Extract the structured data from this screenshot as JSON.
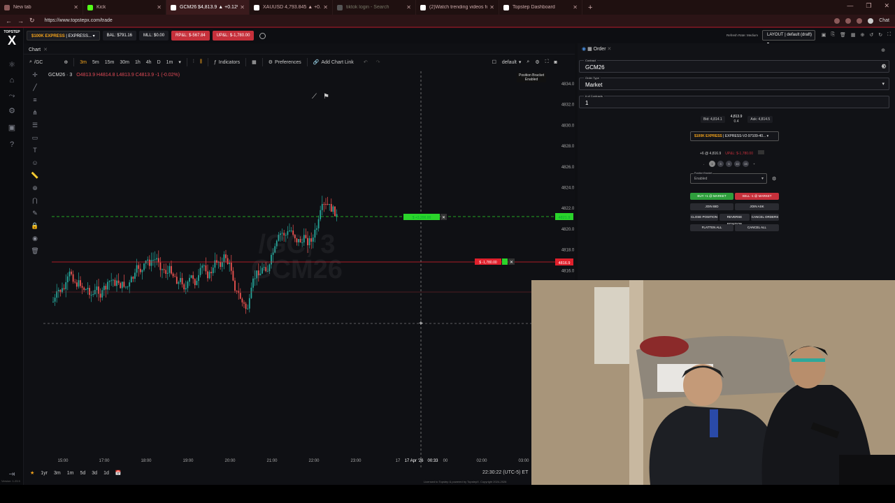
{
  "browser": {
    "tabs": [
      {
        "label": "New tab",
        "color": "#8b5a5a",
        "active": false
      },
      {
        "label": "Kick",
        "color": "#53fc18",
        "active": false
      },
      {
        "label": "GCM26 $4,813.9 ▲ +0.12%",
        "color": "#ffffff",
        "active": true
      },
      {
        "label": "XAUUSD 4,793.845 ▲ +0.07% Un",
        "color": "#ffffff",
        "active": false
      },
      {
        "label": "tiktok login - Search",
        "color": "#6a6a6a",
        "active": false
      },
      {
        "label": "(2)Watch trending videos for you",
        "color": "#ffffff",
        "active": false
      },
      {
        "label": "Topstep Dashboard",
        "color": "#ffffff",
        "active": false
      }
    ],
    "url": "https://www.topstepx.com/trade",
    "chat_label": "Chat"
  },
  "logo": {
    "top": "TOPSTEP",
    "mark": "X"
  },
  "infobar": {
    "account_prefix": "$100K EXPRESS",
    "account_suffix": " | EXPRESS...",
    "balance": "BAL: $791.16",
    "mll": "MLL: $0.00",
    "rpl": "RP&L: $-567.84",
    "upl": "UP&L: $-1,780.00",
    "refresh_rate": "Refresh Rate: Medium",
    "layout": "LAYOUT | default (draft)"
  },
  "chart": {
    "panel_title": "Chart",
    "symbol_search": "/GC",
    "toolbar": [
      "3m",
      "5m",
      "15m",
      "30m",
      "1h",
      "4h",
      "D",
      "1m"
    ],
    "indicators_label": "Indicators",
    "preferences_label": "Preferences",
    "chart_link_label": "Add Chart Link",
    "template_label": "default",
    "symbol_label": "GCM26 · 3",
    "ohlc": "O4813.9 H4814.8 L4813.9 C4813.9 -1 (-0.02%)",
    "watermark_line1": "/GC, 3",
    "watermark_line2": "GCM26",
    "position_bracket_line1": "Position Bracket",
    "position_bracket_line2": "Enabled",
    "y_ticks": [
      "4834.0",
      "4832.0",
      "4830.0",
      "4828.0",
      "4826.0",
      "4824.0",
      "4822.0",
      "4820.0",
      "4818.0",
      "4816.0"
    ],
    "x_ticks": [
      "15:00",
      "17:00",
      "18:00",
      "19:00",
      "20:00",
      "21:00",
      "22:00",
      "23:00",
      "17",
      "17 Apr '26",
      "00:33",
      "00",
      "02:00",
      "03:00"
    ],
    "tp_order_label": "$ +3,200.00",
    "tp_price": "4821.9",
    "sl_order_label": "$ -1,780.00",
    "sl_price": "4816.9",
    "timeframes": [
      "1yr",
      "3m",
      "1m",
      "5d",
      "3d",
      "1d"
    ],
    "clock": "22:30:22 (UTC-5)",
    "clock_suffix": "ET",
    "license": "Licensed to Topstep & powered by TopstepX. Copyright 2024-2026",
    "version": "Version: 1.23.5",
    "tv_logo": "TV",
    "colors": {
      "up": "#26a69a",
      "down": "#ef5350",
      "tp": "#2bd42b",
      "sl": "#e0202c"
    }
  },
  "chart_data": {
    "type": "candlestick",
    "x_axis": [
      "15:00",
      "17:00",
      "18:00",
      "19:00",
      "20:00",
      "21:00",
      "22:00",
      "23:00",
      "00:33",
      "02:00",
      "03:00"
    ],
    "y_range": [
      4814.0,
      4835.0
    ],
    "take_profit": 4821.9,
    "stop_loss": 4816.9
  },
  "order": {
    "title": "Order",
    "contract_label": "Contract",
    "contract_value": "GCM26",
    "order_type_label": "Order Type",
    "order_type_value": "Market",
    "contracts_label": "# of Contracts",
    "contracts_value": "1",
    "bid": "Bid: 4,814.1",
    "last": "4,813.9",
    "last_change": "0.4",
    "ask": "Ask: 4,814.5",
    "account_prefix": "$100K EXPRESS",
    "account_suffix": " | EXPRESS-V2-97109-40...",
    "position": "+6 @ 4,816.9",
    "upnl": "UP&L: $-1,780.00",
    "qty_buttons": [
      "-",
      "1",
      "3",
      "5",
      "10",
      "15",
      "+"
    ],
    "bracket_label": "Position Bracket",
    "bracket_value": "Enabled",
    "buy_market": "BUY +1 @ MARKET",
    "sell_market": "SELL -1 @ MARKET",
    "join_bid": "JOIN BID",
    "join_ask": "JOIN ASK",
    "close_position": "CLOSE POSITION",
    "reverse_position": "REVERSE POSITION",
    "cancel_orders": "CANCEL ORDERS",
    "flatten_all": "FLATTEN ALL",
    "cancel_all": "CANCEL ALL"
  }
}
